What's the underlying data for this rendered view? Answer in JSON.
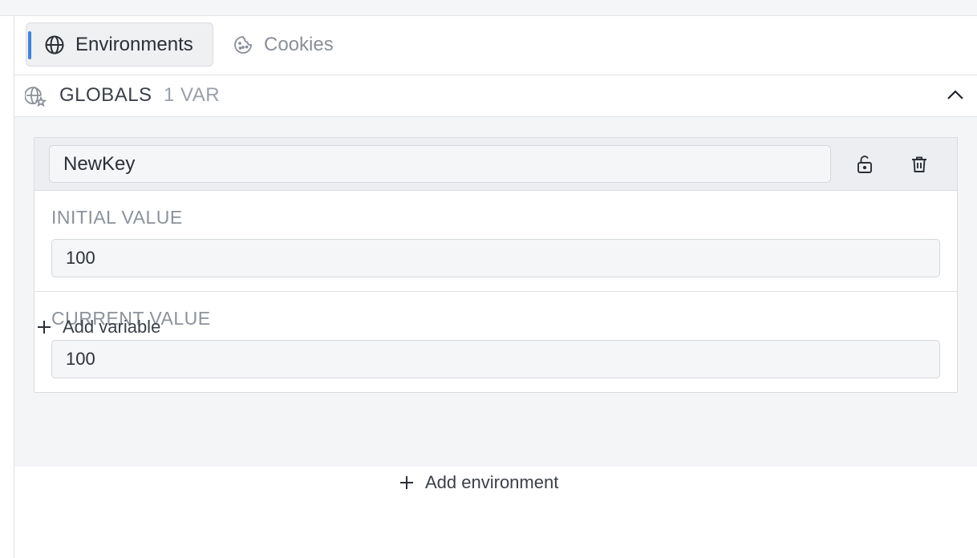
{
  "tabs": {
    "environments_label": "Environments",
    "cookies_label": "Cookies"
  },
  "globals": {
    "title": "GLOBALS",
    "count": "1 VAR"
  },
  "variable": {
    "key": "NewKey",
    "initial_label": "INITIAL VALUE",
    "initial_value": "100",
    "current_label": "CURRENT VALUE",
    "current_value": "100"
  },
  "actions": {
    "add_variable": "Add variable",
    "add_environment": "Add environment"
  },
  "icons": {
    "environments": "globe-icon",
    "cookies": "cookie-icon",
    "globals": "globe-star-icon",
    "collapse": "chevron-up-icon",
    "lock": "unlock-icon",
    "delete": "trash-icon",
    "add": "plus-icon"
  },
  "colors": {
    "accent": "#3d82e6"
  }
}
